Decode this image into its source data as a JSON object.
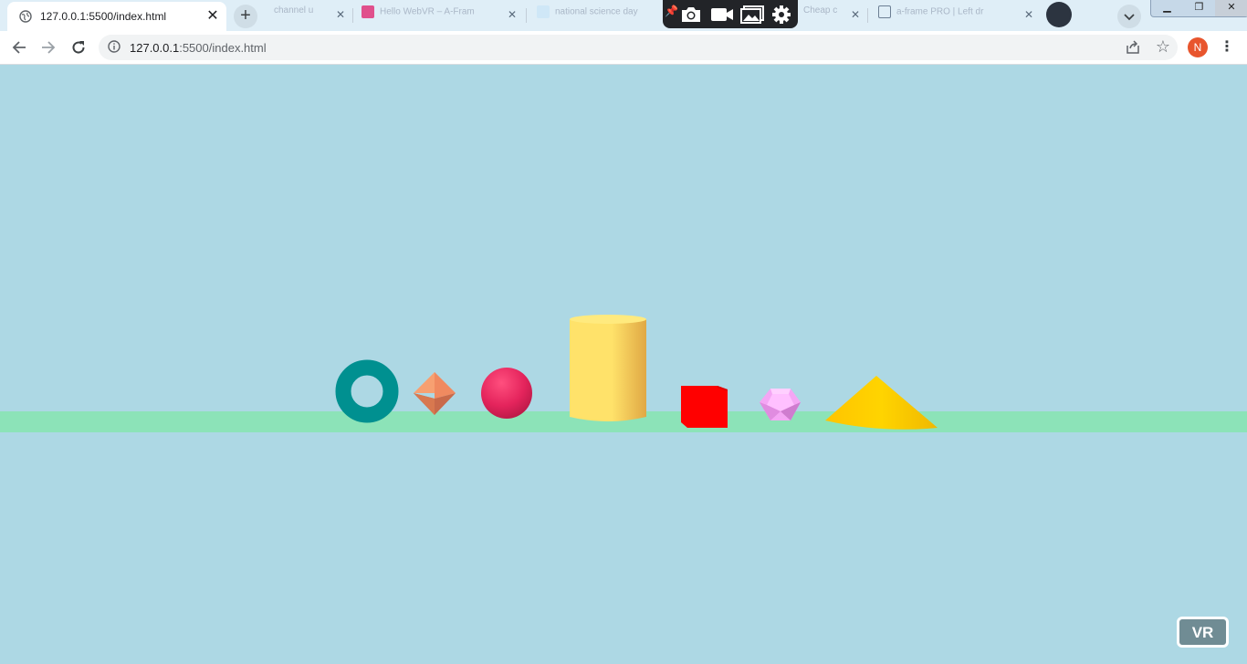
{
  "browser": {
    "active_tab": {
      "title": "127.0.0.1:5500/index.html"
    },
    "background_tabs": [
      {
        "title": "channel u"
      },
      {
        "title": "Hello WebVR – A-Fram"
      },
      {
        "title": "national science day"
      },
      {
        "title": "Cheap c"
      },
      {
        "title": "a-frame PRO | Left dr"
      }
    ],
    "url": {
      "host": "127.0.0.1",
      "rest": ":5500/index.html"
    },
    "profile_initial": "N"
  },
  "scene": {
    "background_color": "#add8e4",
    "ground_color": "#8ce3b8",
    "objects": [
      {
        "name": "torus",
        "color": "#009090"
      },
      {
        "name": "octahedron",
        "color": "#f0946a"
      },
      {
        "name": "sphere",
        "color": "#e4245c"
      },
      {
        "name": "cylinder",
        "color": "#ffe26a"
      },
      {
        "name": "box",
        "color": "#ff0000"
      },
      {
        "name": "dodecahedron",
        "color": "#ffaaff"
      },
      {
        "name": "cone",
        "color": "#ffd400"
      }
    ],
    "vr_button_label": "VR"
  }
}
